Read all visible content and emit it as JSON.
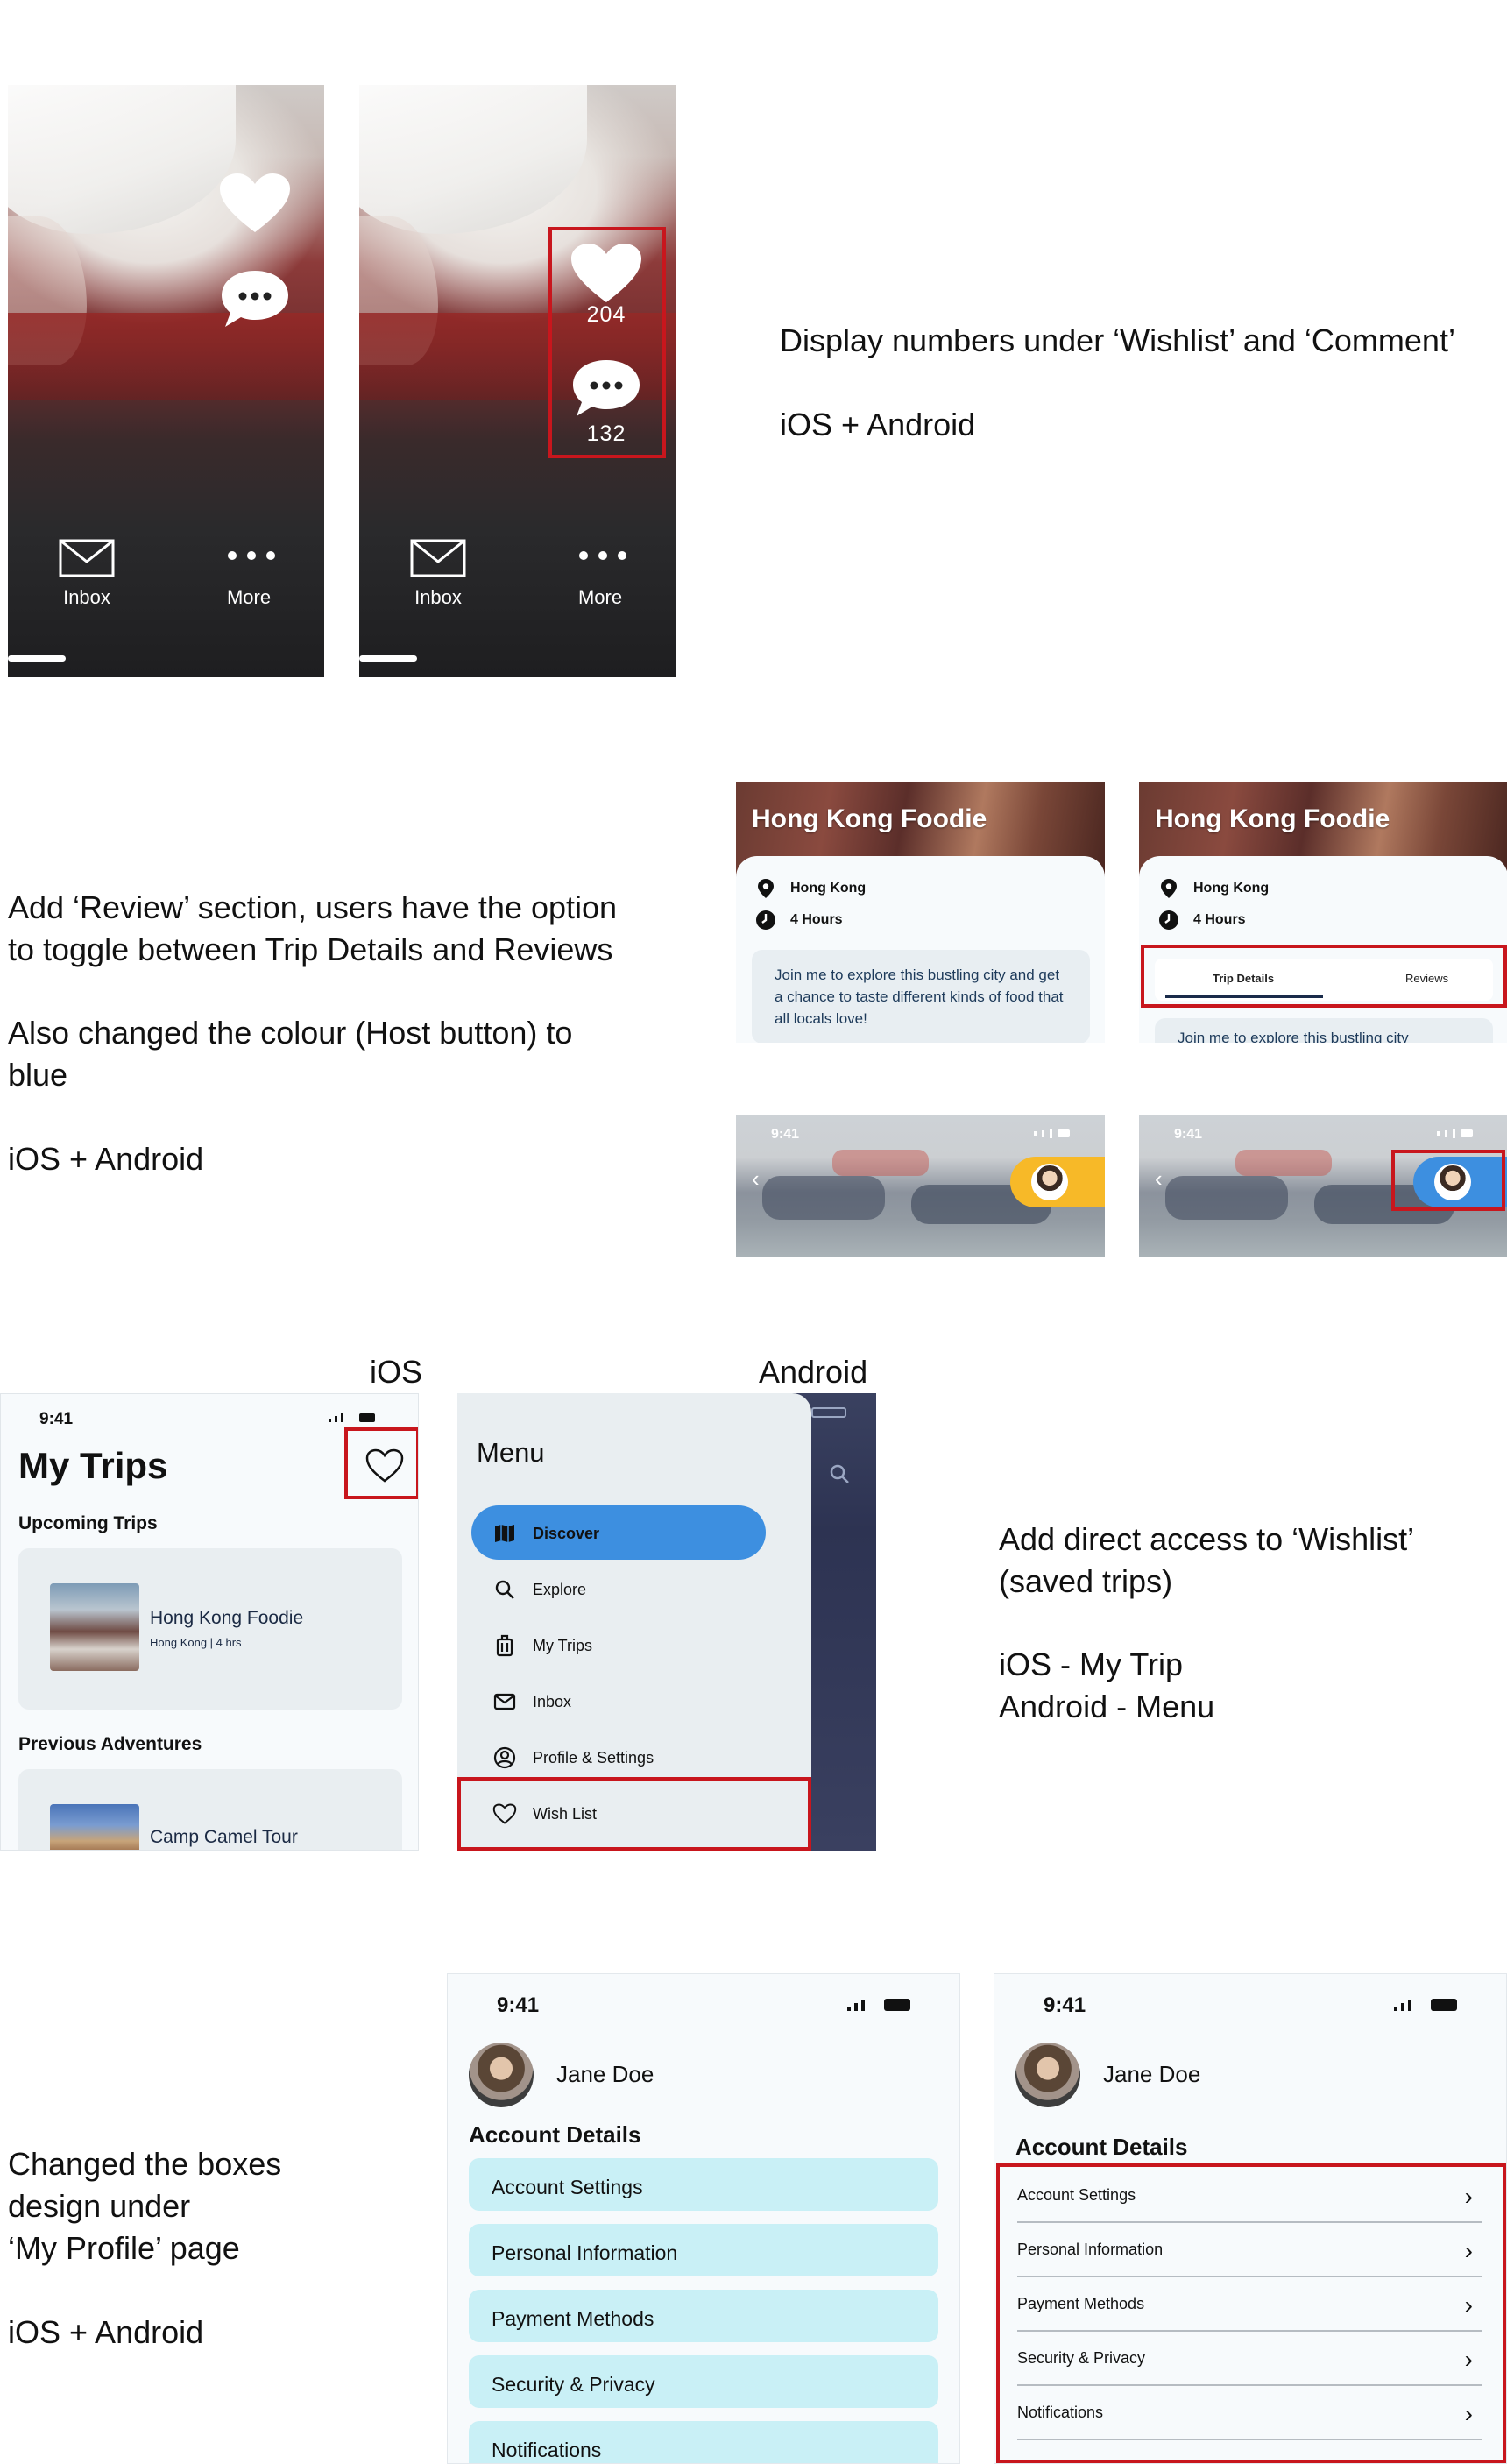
{
  "section1": {
    "screens": [
      {
        "wishlist_count": "",
        "comment_count": "",
        "nav": {
          "inbox": "Inbox",
          "more": "More"
        }
      },
      {
        "wishlist_count": "204",
        "comment_count": "132",
        "nav": {
          "inbox": "Inbox",
          "more": "More"
        }
      }
    ],
    "note_line1": "Display numbers under ‘Wishlist’ and ‘Comment’",
    "note_line2": "iOS + Android"
  },
  "section2": {
    "note": {
      "line1": "Add ‘Review’ section, users have the option",
      "line2": "to toggle between Trip Details and Reviews",
      "line3": "Also changed the colour (Host button) to",
      "line4": "blue",
      "line5": "iOS + Android"
    },
    "card_before": {
      "title": "Hong Kong Foodie",
      "location": "Hong Kong",
      "duration": "4 Hours",
      "description": "Join me to explore this bustling city and get a chance to taste different kinds of food that all locals love!"
    },
    "card_after": {
      "title": "Hong Kong Foodie",
      "location": "Hong Kong",
      "duration": "4 Hours",
      "tab_details": "Trip Details",
      "tab_reviews": "Reviews",
      "description_peek": "Join me to explore this bustling city"
    },
    "photo_before": {
      "time": "9:41",
      "host_color": "#f7b928"
    },
    "photo_after": {
      "time": "9:41",
      "host_color": "#3d8fe0"
    }
  },
  "section3": {
    "label_ios": "iOS",
    "label_android": "Android",
    "ios": {
      "time": "9:41",
      "title": "My Trips",
      "upcoming_label": "Upcoming Trips",
      "upcoming_trip": {
        "name": "Hong Kong Foodie",
        "meta": "Hong Kong | 4 hrs"
      },
      "previous_label": "Previous Adventures",
      "previous_trip": {
        "name": "Camp Camel Tour"
      }
    },
    "android": {
      "menu_title": "Menu",
      "items": [
        "Discover",
        "Explore",
        "My Trips",
        "Inbox",
        "Profile & Settings",
        "Wish List"
      ]
    },
    "note": {
      "line1": "Add direct access to ‘Wishlist’",
      "line2": "(saved trips)",
      "line3": "iOS - My Trip",
      "line4": "Android - Menu"
    }
  },
  "section4": {
    "note": {
      "line1": "Changed the boxes",
      "line2": "design under",
      "line3": "‘My Profile’ page",
      "line4": "iOS + Android"
    },
    "profile_before": {
      "time": "9:41",
      "name": "Jane Doe",
      "section_title": "Account Details",
      "items": [
        "Account Settings",
        "Personal Information",
        "Payment Methods",
        "Security & Privacy",
        "Notifications"
      ]
    },
    "profile_after": {
      "time": "9:41",
      "name": "Jane Doe",
      "section_title": "Account Details",
      "items": [
        "Account Settings",
        "Personal Information",
        "Payment Methods",
        "Security & Privacy",
        "Notifications"
      ]
    }
  },
  "colors": {
    "highlight": "#c8161d",
    "accent_blue": "#3d8fe0",
    "profile_box": "#c9f0f6"
  }
}
